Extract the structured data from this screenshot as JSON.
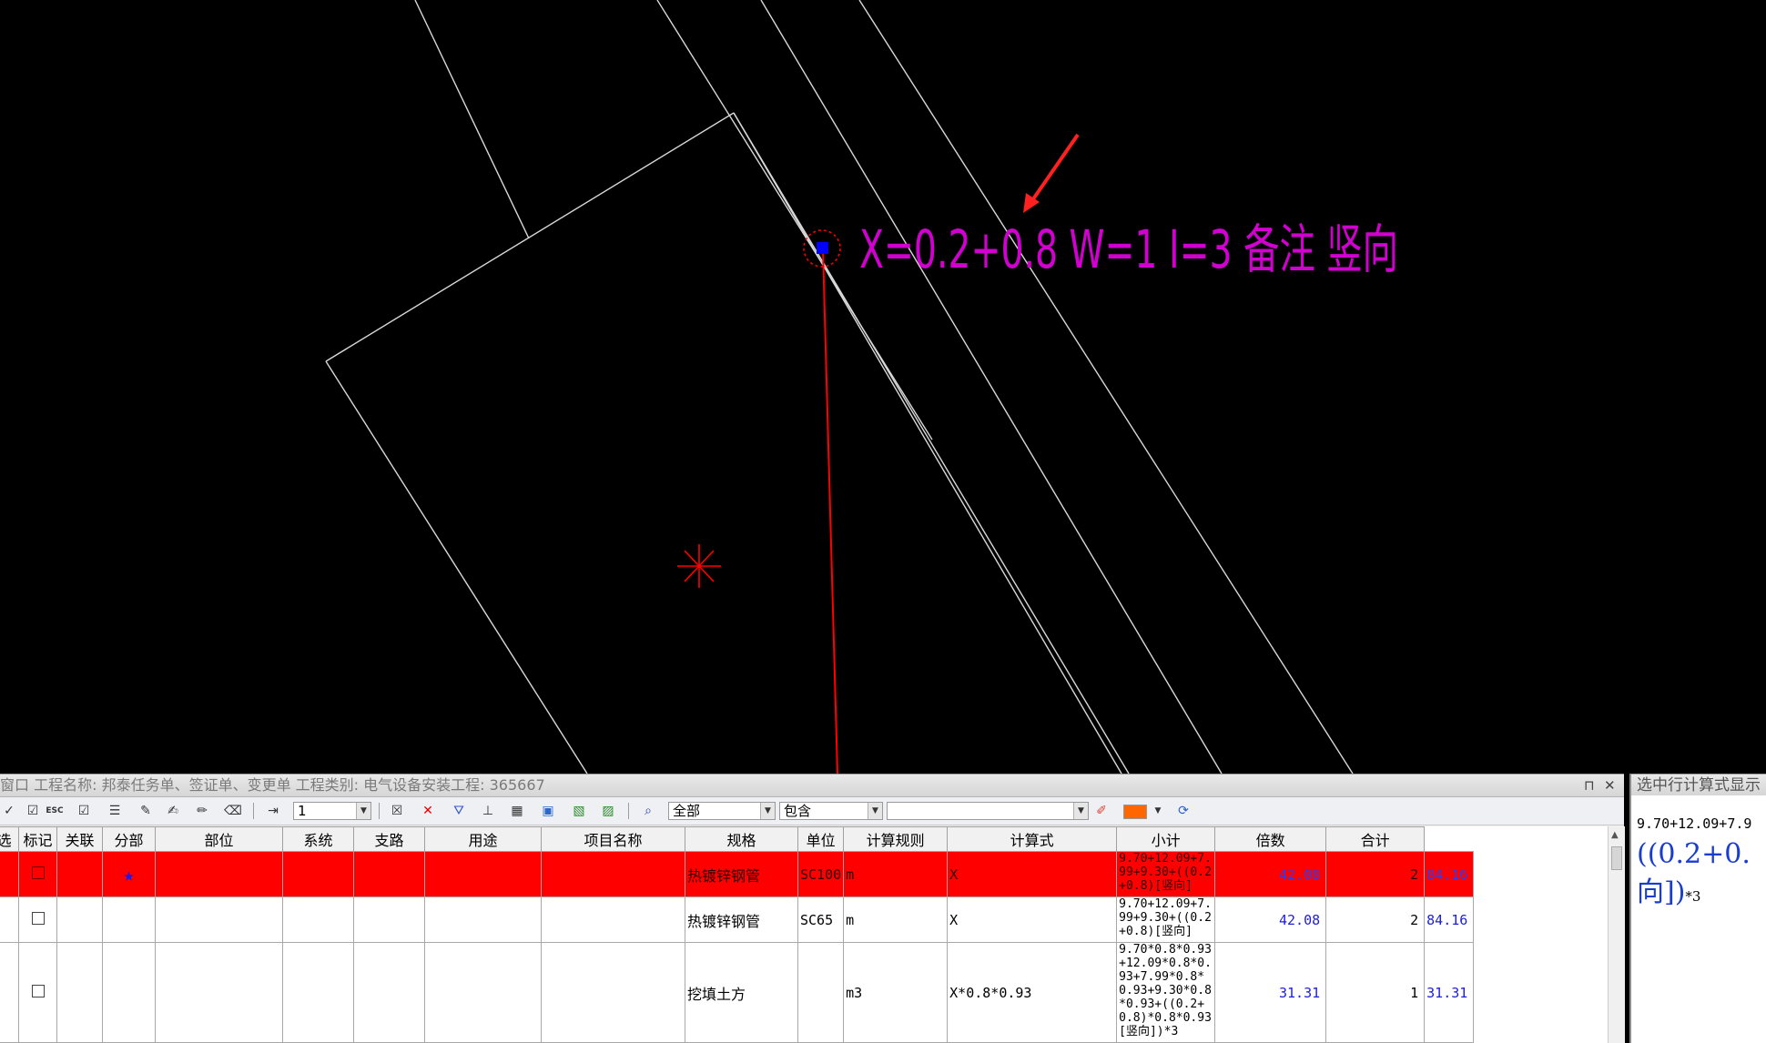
{
  "cad": {
    "annotation": "X=0.2+0.8 W=1 I=3 备注 竖向",
    "colors": {
      "background": "#000000",
      "line": "#d8d8d8",
      "annotation": "#d100d1",
      "marker": "#ff0000",
      "point": "#0000ff"
    }
  },
  "panel": {
    "title": "窗口  工程名称: 邦泰任务单、签证单、变更单  工程类别: 电气设备安装工程: 365667",
    "pin": "⊓",
    "close": "✕"
  },
  "toolbar": {
    "row_input": "1",
    "scope_select": "全部",
    "match_select": "包含",
    "search_input": "",
    "accent_color": "#ff6600"
  },
  "table": {
    "columns": [
      "选",
      "标记",
      "关联",
      "分部",
      "部位",
      "系统",
      "支路",
      "用途",
      "项目名称",
      "规格",
      "单位",
      "计算规则",
      "计算式",
      "小计",
      "倍数",
      "合计"
    ],
    "rows": [
      {
        "selected": true,
        "mark": "",
        "link": "★",
        "name": "热镀锌钢管",
        "spec": "SC100",
        "unit": "m",
        "rule": "X",
        "formula": "9.70+12.09+7.99+9.30+((0.2+0.8)[竖向]",
        "subtotal": "42.08",
        "multiplier": "2",
        "total": "84.16"
      },
      {
        "selected": false,
        "mark": "",
        "link": "",
        "name": "热镀锌钢管",
        "spec": "SC65",
        "unit": "m",
        "rule": "X",
        "formula": "9.70+12.09+7.99+9.30+((0.2+0.8)[竖向]",
        "subtotal": "42.08",
        "multiplier": "2",
        "total": "84.16"
      },
      {
        "selected": false,
        "mark": "",
        "link": "",
        "name": "挖填土方",
        "spec": "",
        "unit": "m3",
        "rule": "X*0.8*0.93",
        "formula": "9.70*0.8*0.93+12.09*0.8*0.93+7.99*0.8*0.93+9.30*0.8*0.93+((0.2+0.8)*0.8*0.93[竖向])*3",
        "subtotal": "31.31",
        "multiplier": "1",
        "total": "31.31"
      }
    ]
  },
  "right_panel": {
    "title": "选中行计算式显示",
    "line1": "9.70+12.09+7.9",
    "big1": "((0.2+0.",
    "big2": "向])",
    "big_suffix": "*3"
  }
}
